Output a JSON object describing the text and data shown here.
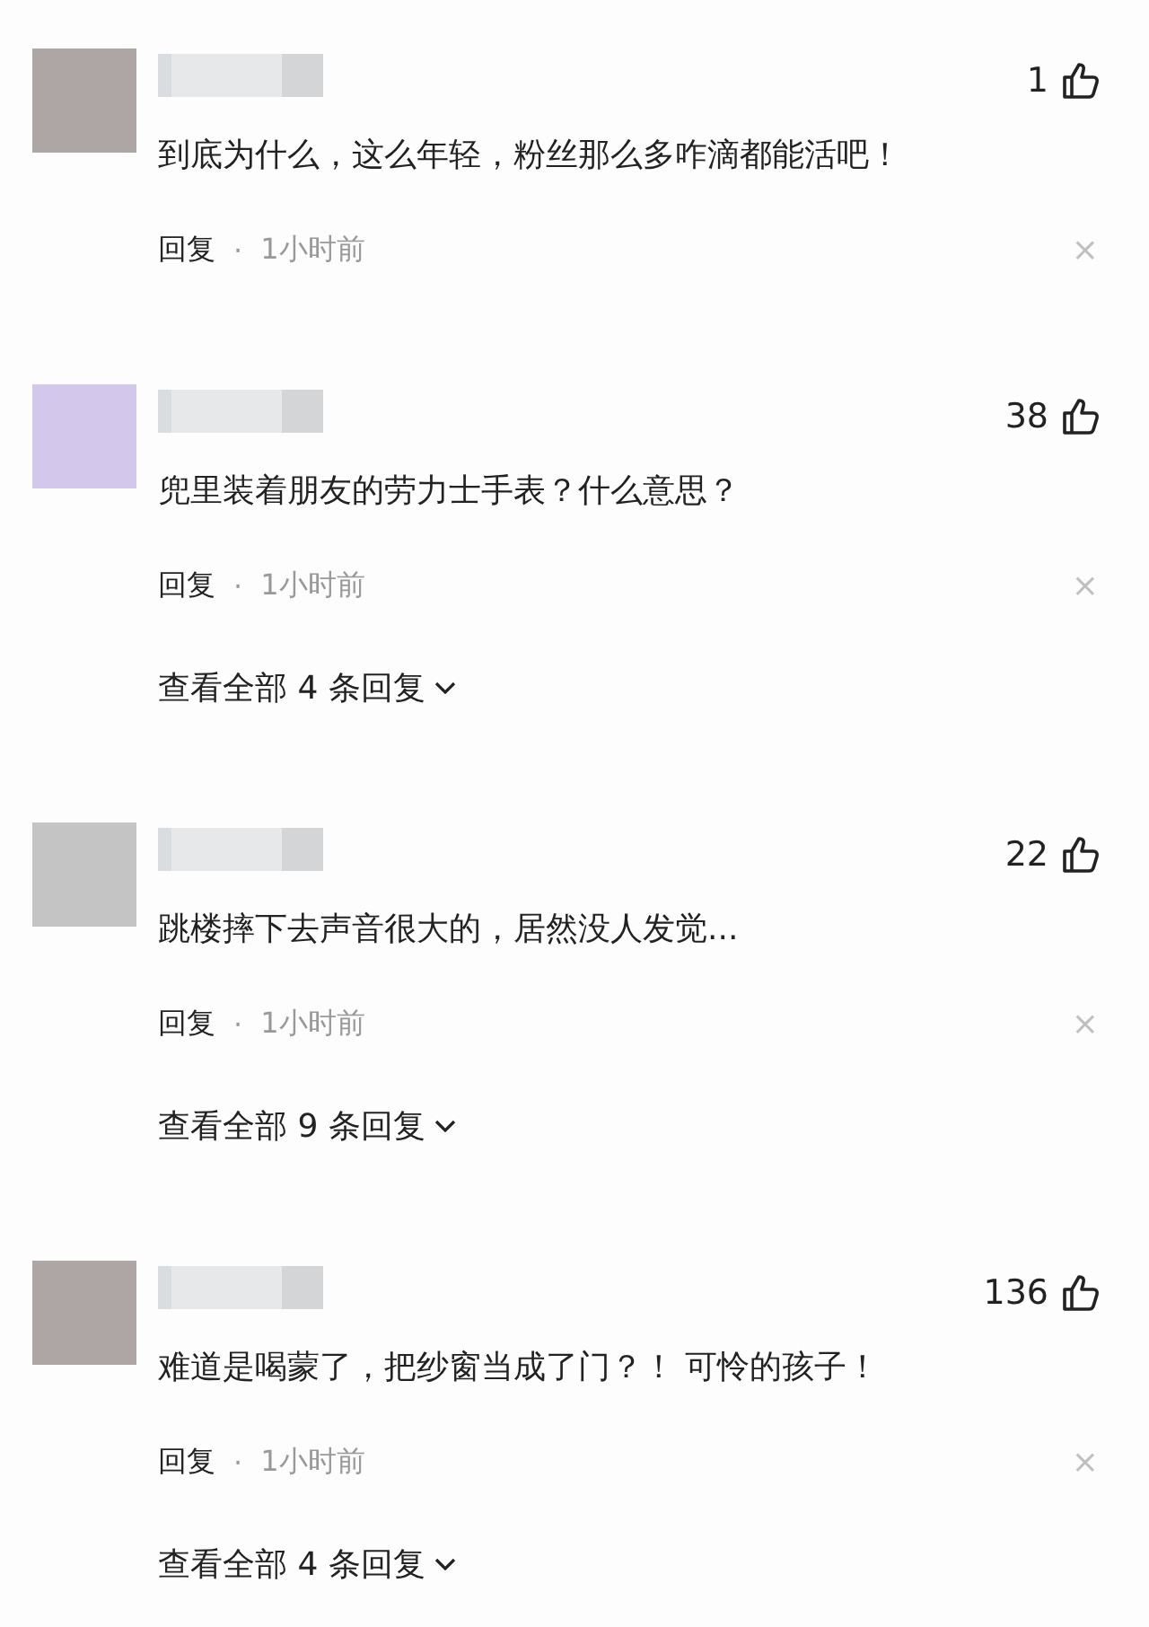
{
  "comments": [
    {
      "color": "#aea5a5",
      "likes": "1",
      "text": "到底为什么，这么年轻，粉丝那么多咋滴都能活吧！",
      "reply": "回复",
      "dot": "·",
      "time": "1小时前",
      "close": "×"
    },
    {
      "color": "#d3c8ec",
      "likes": "38",
      "text": "兜里装着朋友的劳力士手表？什么意思？",
      "reply": "回复",
      "dot": "·",
      "time": "1小时前",
      "close": "×",
      "view_all": "查看全部 4 条回复"
    },
    {
      "color": "#c4c4c4",
      "likes": "22",
      "text": "跳楼摔下去声音很大的，居然没人发觉...",
      "reply": "回复",
      "dot": "·",
      "time": "1小时前",
      "close": "×",
      "view_all": "查看全部 9 条回复"
    },
    {
      "color": "#aea5a5",
      "likes": "136",
      "text": "难道是喝蒙了，把纱窗当成了门？！ 可怜的孩子！",
      "reply": "回复",
      "dot": "·",
      "time": "1小时前",
      "close": "×",
      "view_all": "查看全部 4 条回复"
    }
  ]
}
